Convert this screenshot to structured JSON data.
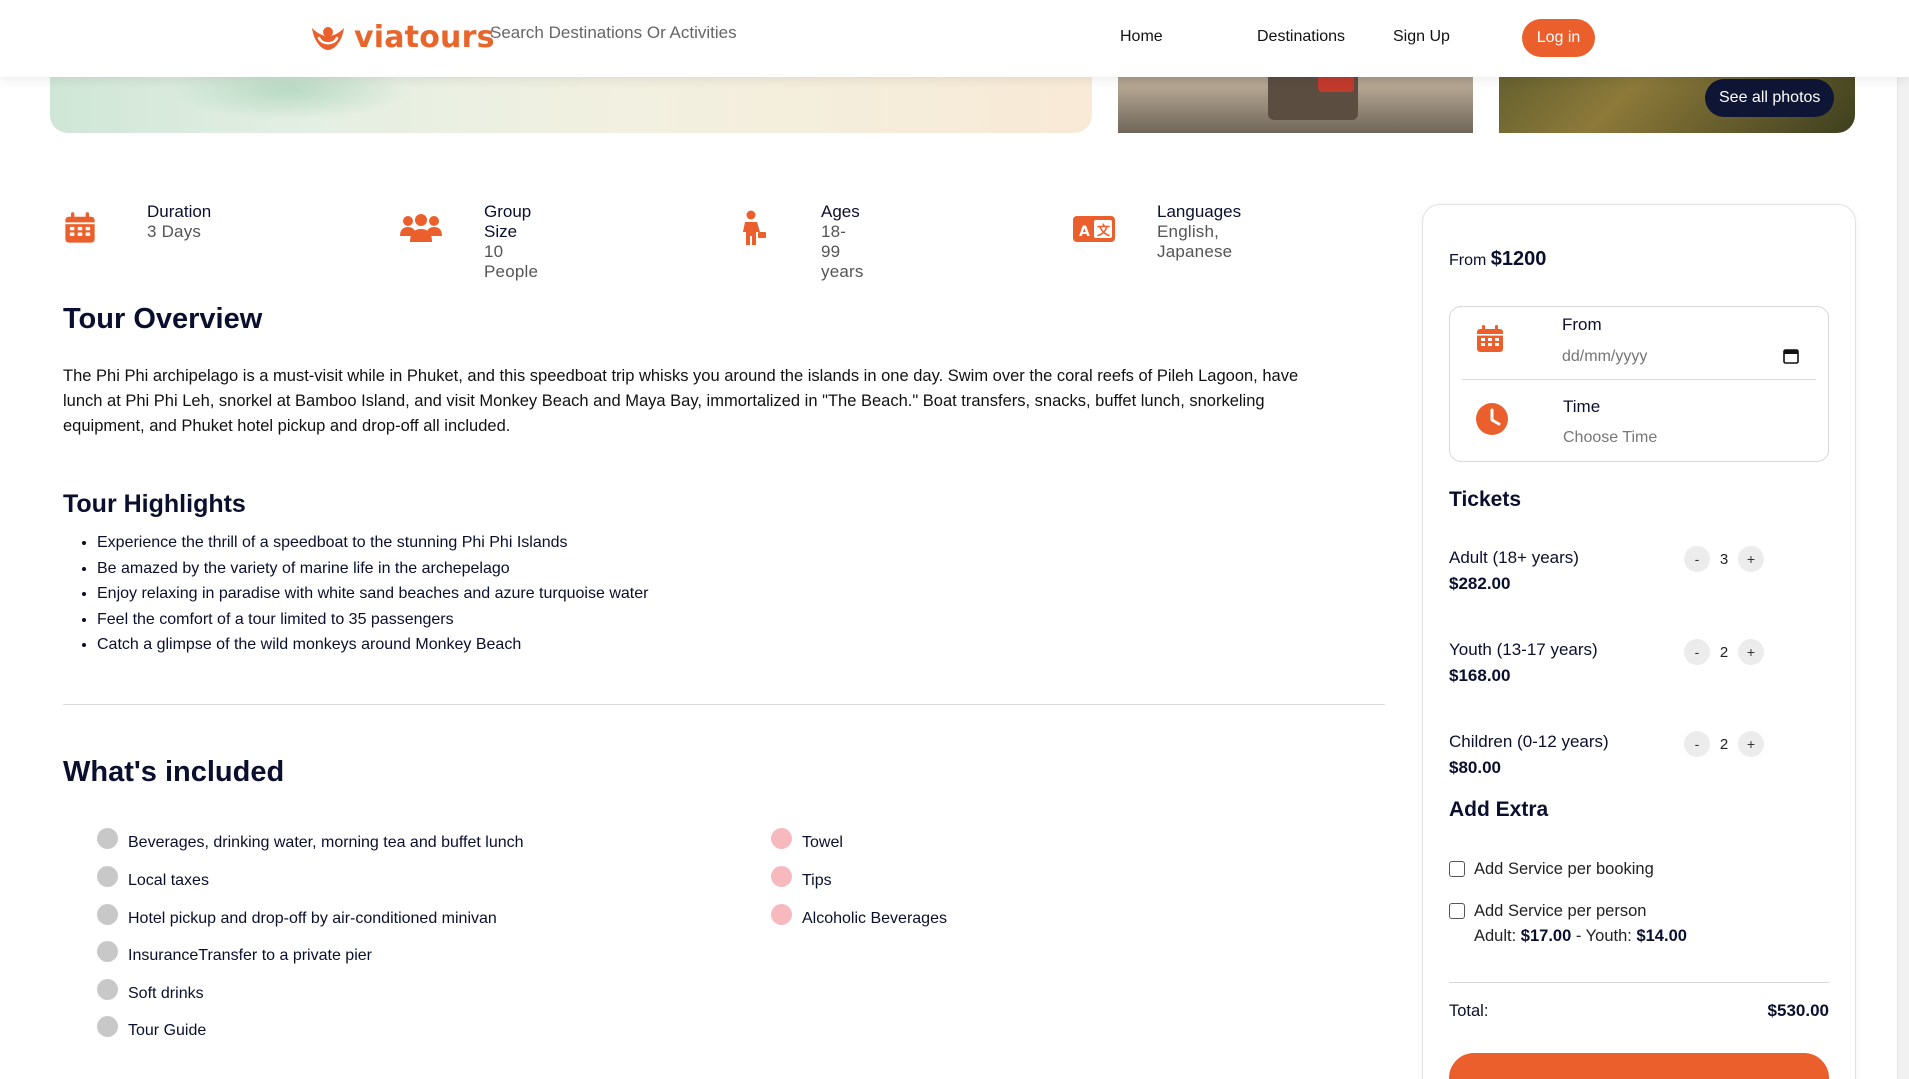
{
  "brand": {
    "name": "viatours",
    "accent": "#ea5f2b",
    "navy": "#0f1535"
  },
  "header": {
    "search_placeholder": "Search Destinations Or Activities",
    "nav": [
      "Home",
      "Destinations",
      "Sign Up"
    ],
    "login_label": "Log in"
  },
  "gallery": {
    "see_all_label": "See all photos"
  },
  "facts": [
    {
      "icon": "calendar-icon",
      "label": "Duration",
      "value": "3 Days"
    },
    {
      "icon": "group-icon",
      "label": "Group Size",
      "value": "10 People"
    },
    {
      "icon": "person-icon",
      "label": "Ages",
      "value": "18-99 years"
    },
    {
      "icon": "language-icon",
      "label": "Languages",
      "value": "English, Japanese"
    }
  ],
  "overview": {
    "title": "Tour Overview",
    "text": "The Phi Phi archipelago is a must-visit while in Phuket, and this speedboat trip whisks you around the islands in one day. Swim over the coral reefs of Pileh Lagoon, have lunch at Phi Phi Leh, snorkel at Bamboo Island, and visit Monkey Beach and Maya Bay, immortalized in \"The Beach.\" Boat transfers, snacks, buffet lunch, snorkeling equipment, and Phuket hotel pickup and drop-off all included."
  },
  "highlights": {
    "title": "Tour Highlights",
    "items": [
      "Experience the thrill of a speedboat to the stunning Phi Phi Islands",
      "Be amazed by the variety of marine life in the archepelago",
      "Enjoy relaxing in paradise with white sand beaches and azure turquoise water",
      "Feel the comfort of a tour limited to 35 passengers",
      "Catch a glimpse of the wild monkeys around Monkey Beach"
    ]
  },
  "included": {
    "title": "What's included",
    "included_items": [
      "Beverages, drinking water, morning tea and buffet lunch",
      "Local taxes",
      "Hotel pickup and drop-off by air-conditioned minivan",
      "InsuranceTransfer to a private pier",
      "Soft drinks",
      "Tour Guide"
    ],
    "excluded_items": [
      "Towel",
      "Tips",
      "Alcoholic Beverages"
    ]
  },
  "booking": {
    "from_label": "From",
    "from_price": "$1200",
    "date_label": "From",
    "date_placeholder": "dd/mm/yyyy",
    "time_label": "Time",
    "time_value": "Choose Time",
    "tickets_title": "Tickets",
    "tickets": [
      {
        "name": "Adult (18+ years)",
        "price": "$282.00",
        "qty": "3"
      },
      {
        "name": "Youth (13-17 years)",
        "price": "$168.00",
        "qty": "2"
      },
      {
        "name": "Children (0-12 years)",
        "price": "$80.00",
        "qty": "2"
      }
    ],
    "minus": "-",
    "plus": "+",
    "extra_title": "Add Extra",
    "extras": [
      "Add Service per booking",
      "Add Service per person"
    ],
    "extra_adult_label": "Adult:",
    "extra_adult_price": "$17.00",
    "extra_sep": "-",
    "extra_youth_label": "Youth:",
    "extra_youth_price": "$14.00",
    "total_label": "Total:",
    "total_value": "$530.00"
  }
}
